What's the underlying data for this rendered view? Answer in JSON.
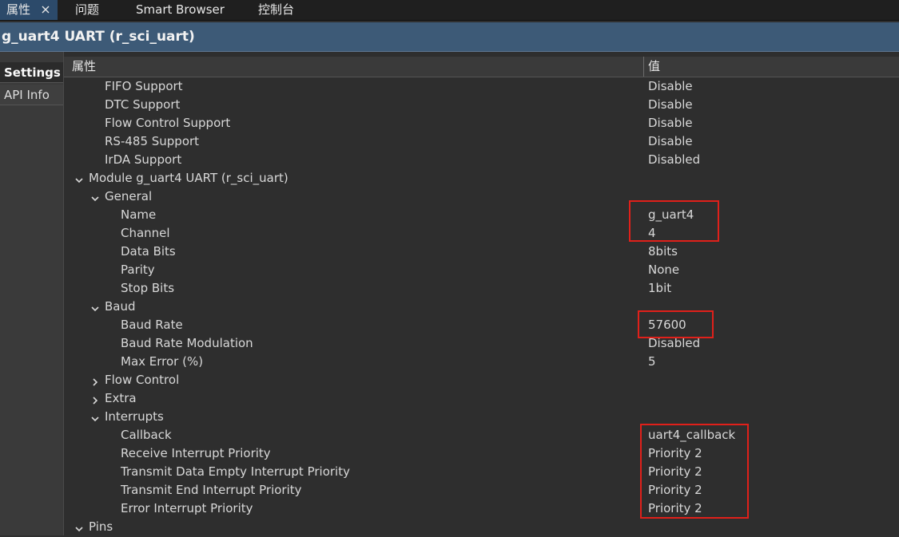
{
  "tabs": [
    {
      "label": "属性",
      "active": true,
      "closable": true
    },
    {
      "label": "问题",
      "active": false
    },
    {
      "label": "Smart Browser",
      "active": false
    },
    {
      "label": "控制台",
      "active": false
    }
  ],
  "title": "g_uart4 UART (r_sci_uart)",
  "sidebar": [
    {
      "label": "Settings",
      "selected": true
    },
    {
      "label": "API Info",
      "selected": false
    }
  ],
  "table": {
    "col_property": "属性",
    "col_value": "值",
    "rows": [
      {
        "label": "FIFO Support",
        "value": "Disable",
        "level": 2
      },
      {
        "label": "DTC Support",
        "value": "Disable",
        "level": 2
      },
      {
        "label": "Flow Control Support",
        "value": "Disable",
        "level": 2
      },
      {
        "label": "RS-485 Support",
        "value": "Disable",
        "level": 2
      },
      {
        "label": "IrDA Support",
        "value": "Disabled",
        "level": 2
      },
      {
        "label": "Module g_uart4 UART (r_sci_uart)",
        "value": "",
        "level": 0,
        "toggle": "expanded"
      },
      {
        "label": "General",
        "value": "",
        "level": 1,
        "toggle": "expanded"
      },
      {
        "label": "Name",
        "value": "g_uart4",
        "level": 3
      },
      {
        "label": "Channel",
        "value": "4",
        "level": 3
      },
      {
        "label": "Data Bits",
        "value": "8bits",
        "level": 3
      },
      {
        "label": "Parity",
        "value": "None",
        "level": 3
      },
      {
        "label": "Stop Bits",
        "value": "1bit",
        "level": 3
      },
      {
        "label": "Baud",
        "value": "",
        "level": 1,
        "toggle": "expanded"
      },
      {
        "label": "Baud Rate",
        "value": "57600",
        "level": 3
      },
      {
        "label": "Baud Rate Modulation",
        "value": "Disabled",
        "level": 3
      },
      {
        "label": "Max Error (%)",
        "value": "5",
        "level": 3
      },
      {
        "label": "Flow Control",
        "value": "",
        "level": 1,
        "toggle": "collapsed"
      },
      {
        "label": "Extra",
        "value": "",
        "level": 1,
        "toggle": "collapsed"
      },
      {
        "label": "Interrupts",
        "value": "",
        "level": 1,
        "toggle": "expanded"
      },
      {
        "label": "Callback",
        "value": "uart4_callback",
        "level": 3
      },
      {
        "label": "Receive Interrupt Priority",
        "value": "Priority 2",
        "level": 3
      },
      {
        "label": "Transmit Data Empty Interrupt Priority",
        "value": "Priority 2",
        "level": 3
      },
      {
        "label": "Transmit End Interrupt Priority",
        "value": "Priority 2",
        "level": 3
      },
      {
        "label": "Error Interrupt Priority",
        "value": "Priority 2",
        "level": 3
      },
      {
        "label": "Pins",
        "value": "",
        "level": 0,
        "toggle": "expanded"
      }
    ]
  },
  "colors": {
    "highlight": "#e0201a",
    "title_bar": "#3d5a77",
    "active_tab": "#2c4a6a"
  }
}
